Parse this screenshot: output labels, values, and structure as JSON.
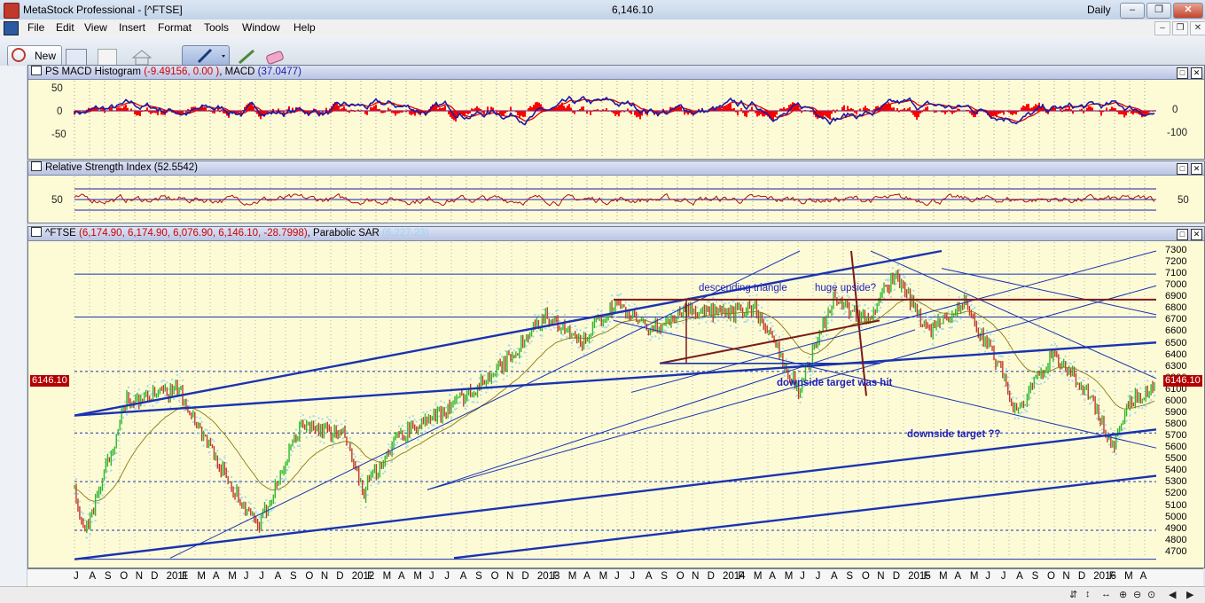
{
  "window": {
    "title": "MetaStock Professional - [^FTSE]",
    "last_price": "6,146.10",
    "periodicity": "Daily",
    "buttons": [
      "–",
      "❐",
      "✕"
    ]
  },
  "menu": {
    "items": [
      "File",
      "Edit",
      "View",
      "Insert",
      "Format",
      "Tools",
      "Window",
      "Help"
    ],
    "mdi_buttons": [
      "–",
      "❐",
      "✕"
    ]
  },
  "toolbar": {
    "new_label": "New"
  },
  "macd_pane": {
    "title_prefix": "PS MACD Histogram ",
    "title_values": "(-9.49156, 0.00 )",
    "title_mid": ", MACD ",
    "title_macd": "(37.0477)",
    "left_ticks": [
      "50",
      "0",
      "-50"
    ],
    "right_ticks": [
      "0",
      "-100"
    ]
  },
  "rsi_pane": {
    "title_prefix": "Relative Strength Index ",
    "title_value": "(52.5542)",
    "left_ticks": [
      "50"
    ],
    "right_ticks": [
      "50"
    ]
  },
  "price_pane": {
    "title_symbol": "^FTSE ",
    "title_ohlc": "(6,174.90, 6,174.90, 6,076.90, 6,146.10, -28.7998)",
    "title_mid": ", Parabolic SAR ",
    "title_sar": "(6,227.23)",
    "last_price_box": "6146.10",
    "right_ticks": [
      "7300",
      "7200",
      "7100",
      "7000",
      "6900",
      "6800",
      "6700",
      "6600",
      "6500",
      "6400",
      "6300",
      "6200",
      "6100",
      "6000",
      "5900",
      "5800",
      "5700",
      "5600",
      "5500",
      "5400",
      "5300",
      "5200",
      "5100",
      "5000",
      "4900",
      "4800",
      "4700"
    ],
    "annotations": {
      "descending_triangle": "descending triangle",
      "huge_upside": "huge upside?",
      "downside_hit": "downside target was hit",
      "downside_target": "downside target ??"
    }
  },
  "date_axis": {
    "labels": [
      "J",
      "A",
      "S",
      "O",
      "N",
      "D",
      "2011",
      "F",
      "M",
      "A",
      "M",
      "J",
      "J",
      "A",
      "S",
      "O",
      "N",
      "D",
      "2012",
      "F",
      "M",
      "A",
      "M",
      "J",
      "J",
      "A",
      "S",
      "O",
      "N",
      "D",
      "2013",
      "F",
      "M",
      "A",
      "M",
      "J",
      "J",
      "A",
      "S",
      "O",
      "N",
      "D",
      "2014",
      "F",
      "M",
      "A",
      "M",
      "J",
      "J",
      "A",
      "S",
      "O",
      "N",
      "D",
      "2015",
      "F",
      "M",
      "A",
      "M",
      "J",
      "J",
      "A",
      "S",
      "O",
      "N",
      "D",
      "2016",
      "F",
      "M",
      "A"
    ]
  },
  "colors": {
    "chart_bg": "#fdfbd6",
    "histogram": "#ff0000",
    "macd_line": "#1a1aa8",
    "signal_line": "#e00000",
    "trendline": "#1a33b0",
    "resistance": "#7a1a1a",
    "up_bar": "#2db82d",
    "down_bar": "#c0392b",
    "sar": "#a8dcf0"
  },
  "icons": [
    "metastock-app-icon",
    "pencil-tool-icon",
    "eraser-icon",
    "zoom-icon"
  ]
}
